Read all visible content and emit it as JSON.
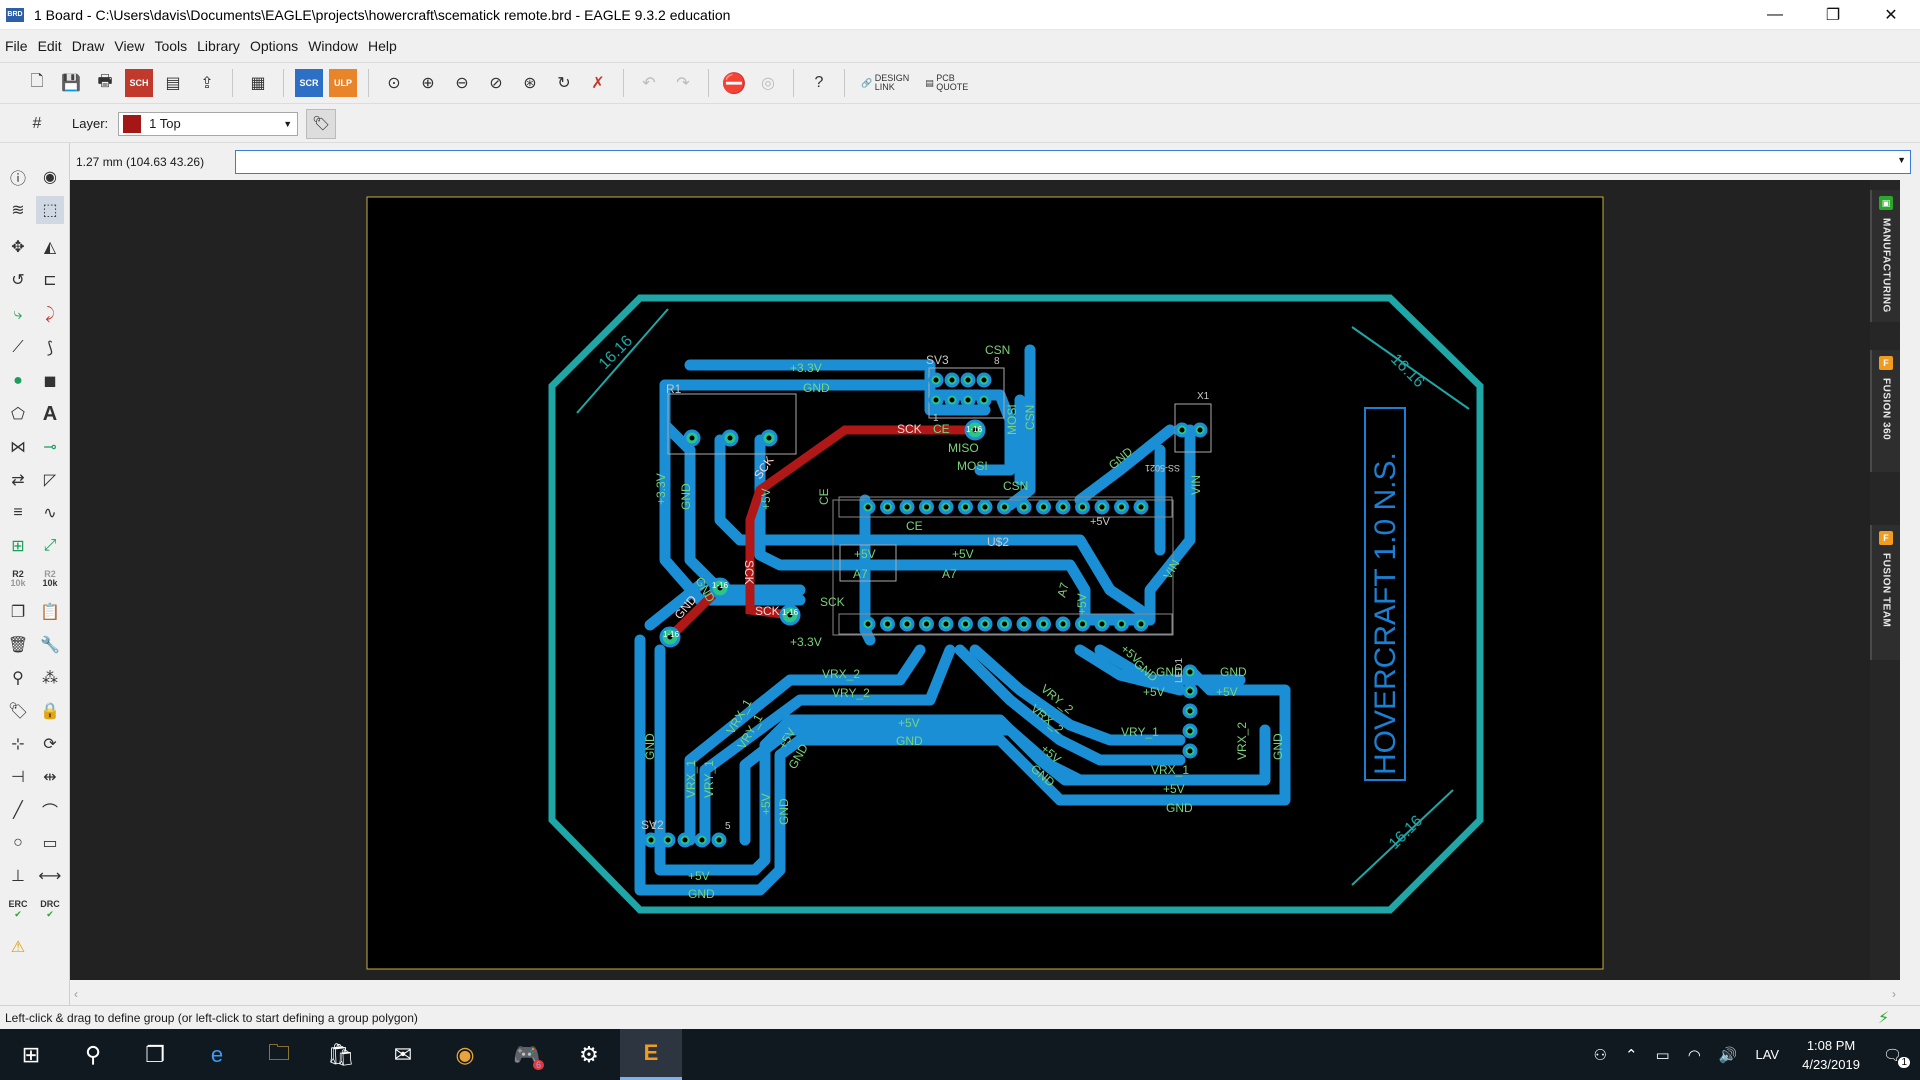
{
  "window": {
    "title": "1 Board - C:\\Users\\davis\\Documents\\EAGLE\\projects\\howercraft\\scematick remote.brd - EAGLE 9.3.2 education",
    "app_icon": "BRD",
    "minimize": "—",
    "restore": "❐",
    "close": "✕"
  },
  "menu": [
    "File",
    "Edit",
    "Draw",
    "View",
    "Tools",
    "Library",
    "Options",
    "Window",
    "Help"
  ],
  "toolbar": {
    "sch_label": "SCH",
    "scr_label": "SCR",
    "ulp_label": "ULP",
    "design_link": [
      "DESIGN",
      "LINK"
    ],
    "pcb_quote": [
      "PCB",
      "QUOTE"
    ],
    "help": "?"
  },
  "layer_bar": {
    "label": "Layer:",
    "selected": "1 Top",
    "swatch_color": "#a51717"
  },
  "coords": "1.27 mm (104.63 43.26)",
  "left_tools": {
    "r2_label": "R2",
    "r2_value": "10k",
    "erc": "ERC",
    "drc": "DRC"
  },
  "side_panel": [
    {
      "label": "MANUFACTURING",
      "icon_color": "#2aa82a"
    },
    {
      "label": "FUSION 360",
      "icon_color": "#f29c1f"
    },
    {
      "label": "FUSION TEAM",
      "icon_color": "#f29c1f"
    }
  ],
  "status": "Left-click & drag to define group (or left-click to start defining a group polygon)",
  "board": {
    "title_vertical": "HOVERCRAFT 1.0 N.S.",
    "dimension_labels": [
      "16.16",
      "16.16",
      "16.16"
    ],
    "parts": [
      "R1",
      "SV3",
      "U$2",
      "SV2",
      "X1",
      "LED1"
    ],
    "pin_numbers": [
      "1",
      "8",
      "1",
      "5"
    ],
    "net_labels": [
      "+3.3V",
      "GND",
      "CSN",
      "SCK",
      "CE",
      "MISO",
      "MOSI",
      "A7",
      "+5V",
      "VIN",
      "VRX_1",
      "VRY_1",
      "VRX_2",
      "VRY_2"
    ],
    "via_label": "1-16",
    "x1_text": "SS-5021"
  },
  "taskbar": {
    "lang": "LAV",
    "time": "1:08 PM",
    "date": "4/23/2019",
    "notif_count": "1",
    "discord_badge": "6"
  }
}
